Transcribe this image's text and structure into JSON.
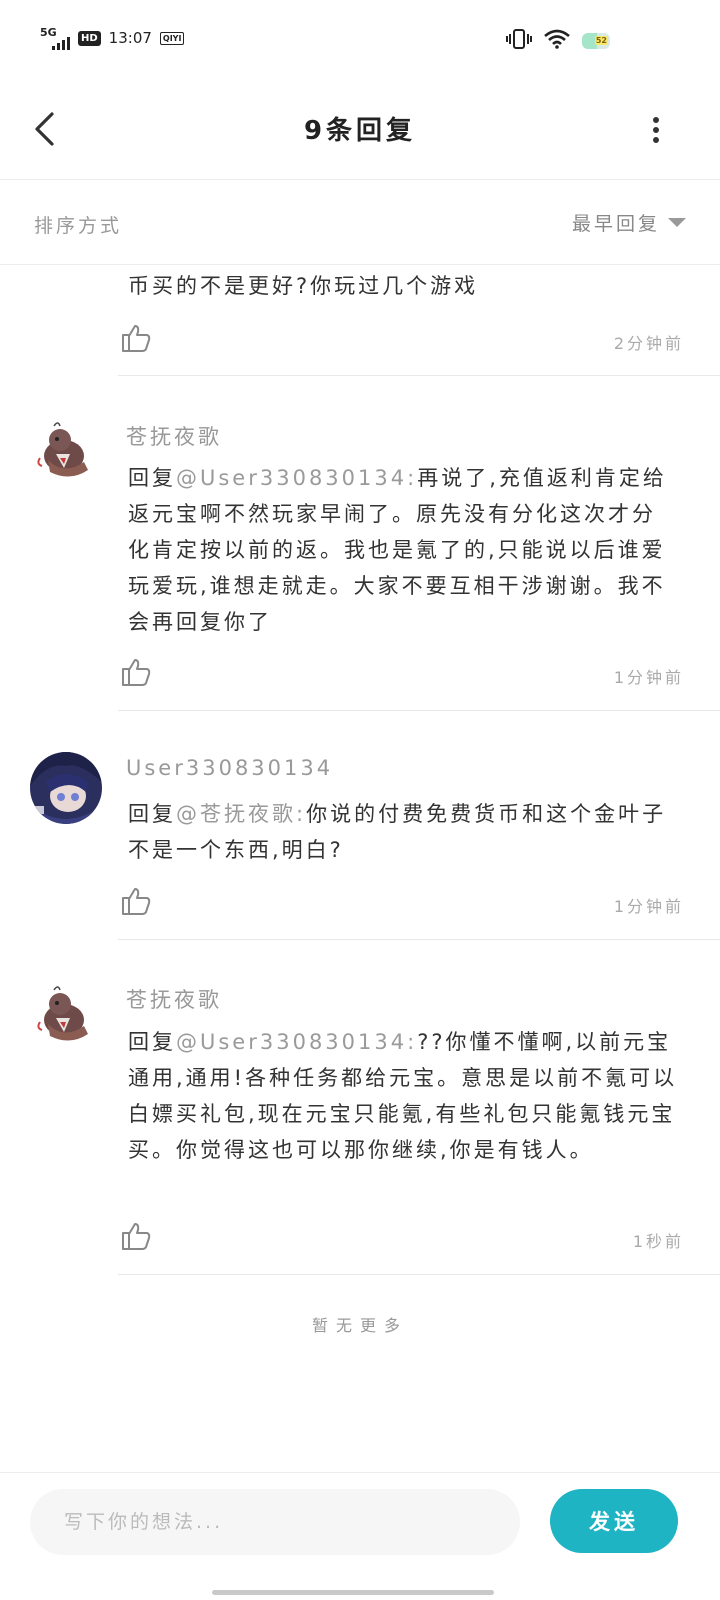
{
  "status_bar": {
    "network": "5G",
    "hd": "HD",
    "time": "13:07",
    "app_badge": "QIYI",
    "battery": "52"
  },
  "header": {
    "title": "9条回复"
  },
  "sort": {
    "label": "排序方式",
    "value": "最早回复"
  },
  "replies": [
    {
      "text": "币买的不是更好?你玩过几个游戏",
      "time": "2分钟前"
    },
    {
      "author": "苍抚夜歌",
      "prefix": "回复",
      "mention": "@User330830134:",
      "text": "再说了,充值返利肯定给返元宝啊不然玩家早闹了。原先没有分化这次才分化肯定按以前的返。我也是氪了的,只能说以后谁爱玩爱玩,谁想走就走。大家不要互相干涉谢谢。我不会再回复你了",
      "time": "1分钟前"
    },
    {
      "author": "User330830134",
      "prefix": "回复",
      "mention": "@苍抚夜歌:",
      "text": "你说的付费免费货币和这个金叶子不是一个东西,明白?",
      "time": "1分钟前"
    },
    {
      "author": "苍抚夜歌",
      "prefix": "回复",
      "mention": "@User330830134:",
      "text": "??你懂不懂啊,以前元宝通用,通用!各种任务都给元宝。意思是以前不氪可以白嫖买礼包,现在元宝只能氪,有些礼包只能氪钱元宝买。你觉得这也可以那你继续,你是有钱人。",
      "time": "1秒前"
    }
  ],
  "no_more": "暂无更多",
  "input": {
    "placeholder": "写下你的想法..."
  },
  "send_label": "发送",
  "colors": {
    "accent": "#1eb4c4",
    "muted_text": "#999999"
  }
}
